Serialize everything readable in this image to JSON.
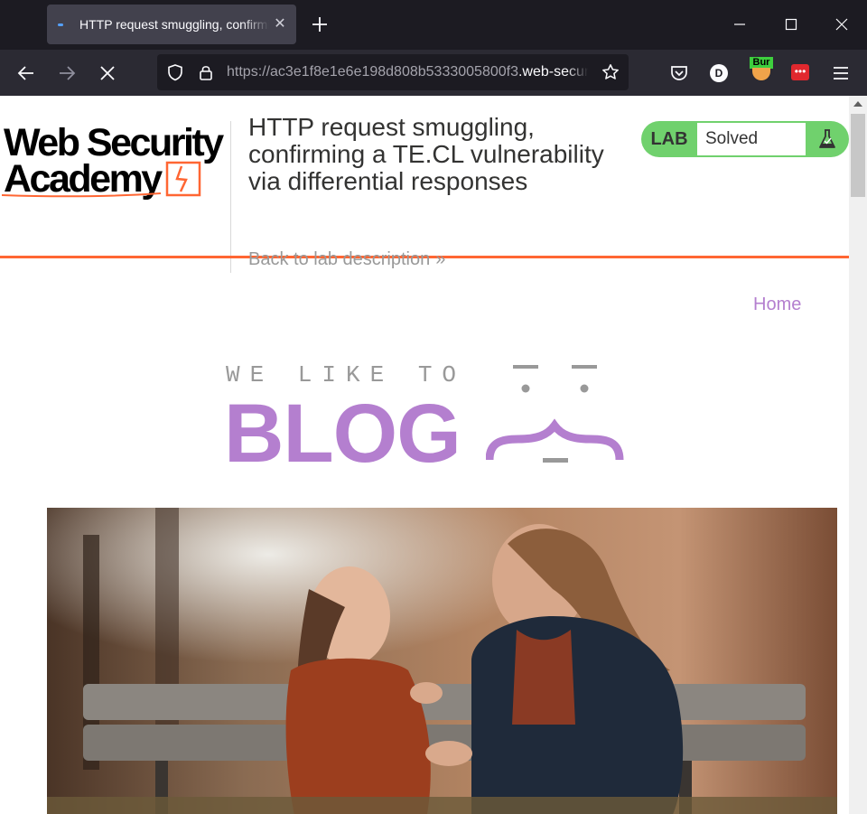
{
  "browser": {
    "tab_title": "HTTP request smuggling, confirming a TE.CL vulnerability via differential responses",
    "url_protocol": "https://",
    "url_host": "ac3e1f8e1e6e198d808b5333005800f3",
    "url_domain": ".web-security-academy.net",
    "profile_initial": "D",
    "burp_label": "Bur",
    "ext_label": "•••"
  },
  "header": {
    "logo_line1": "Web Security",
    "logo_line2": "Academy",
    "lab_title": "HTTP request smuggling, confirming a TE.CL vulnerability via differential responses",
    "back_link": "Back to lab description",
    "back_chevron": "»",
    "lab_badge": "LAB",
    "lab_status": "Solved",
    "accent_color": "#ff6633",
    "solved_color": "#70d16d"
  },
  "nav": {
    "home": "Home"
  },
  "blog": {
    "tagline": "WE LIKE TO",
    "word": "BLOG",
    "brand_color": "#b47fcf"
  }
}
